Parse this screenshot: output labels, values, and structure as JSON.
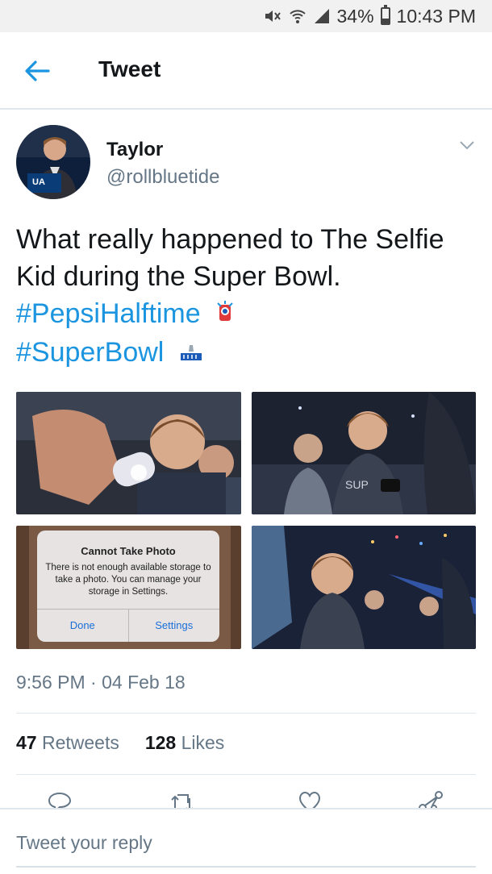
{
  "status_bar": {
    "battery": "34%",
    "battery_level": 0.34,
    "time": "10:43 PM"
  },
  "header": {
    "title": "Tweet"
  },
  "tweet": {
    "author_name": "Taylor",
    "author_handle": "@rollbluetide",
    "text_plain": "What really happened to The Selfie Kid during the Super Bowl.",
    "hashtags": [
      "#PepsiHalftime",
      "#SuperBowl"
    ],
    "timestamp": "9:56 PM · 04 Feb 18",
    "retweets_count": "47",
    "retweets_label": "Retweets",
    "likes_count": "128",
    "likes_label": "Likes"
  },
  "media": {
    "photo3_alert": {
      "title": "Cannot Take Photo",
      "message": "There is not enough available storage to take a photo. You can manage your storage in Settings.",
      "button_left": "Done",
      "button_right": "Settings"
    }
  },
  "reply": {
    "placeholder": "Tweet your reply"
  },
  "colors": {
    "accent": "#1b95e0",
    "secondary_text": "#657786",
    "divider": "#e1e8ed"
  }
}
